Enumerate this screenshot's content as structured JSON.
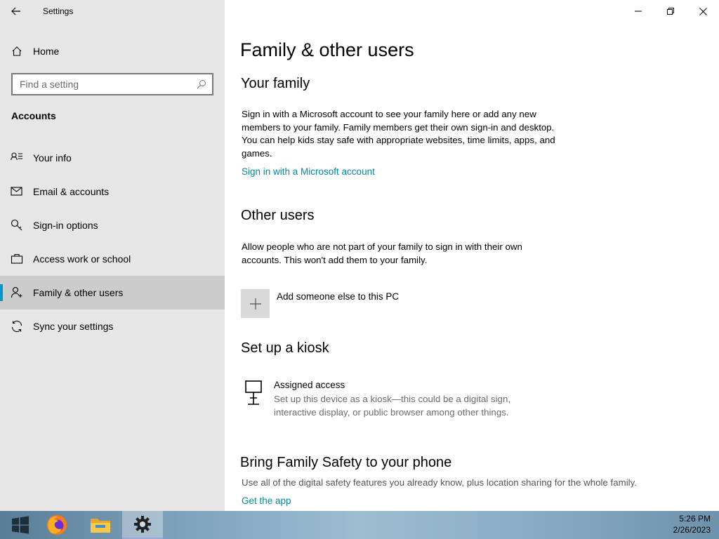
{
  "app": {
    "title": "Settings"
  },
  "sidebar": {
    "home_label": "Home",
    "search_placeholder": "Find a setting",
    "section": "Accounts",
    "items": [
      {
        "label": "Your info",
        "icon": "person-list-icon"
      },
      {
        "label": "Email & accounts",
        "icon": "mail-icon"
      },
      {
        "label": "Sign-in options",
        "icon": "key-icon"
      },
      {
        "label": "Access work or school",
        "icon": "briefcase-icon"
      },
      {
        "label": "Family & other users",
        "icon": "person-add-icon",
        "selected": true
      },
      {
        "label": "Sync your settings",
        "icon": "sync-icon"
      }
    ]
  },
  "main": {
    "title": "Family & other users",
    "family": {
      "heading": "Your family",
      "text": "Sign in with a Microsoft account to see your family here or add any new members to your family. Family members get their own sign-in and desktop. You can help kids stay safe with appropriate websites, time limits, apps, and games.",
      "link": "Sign in with a Microsoft account"
    },
    "other": {
      "heading": "Other users",
      "text": "Allow people who are not part of your family to sign in with their own accounts. This won't add them to your family.",
      "add_label": "Add someone else to this PC"
    },
    "kiosk": {
      "heading": "Set up a kiosk",
      "title": "Assigned access",
      "desc": "Set up this device as a kiosk—this could be a digital sign, interactive display, or public browser among other things."
    },
    "safety": {
      "heading": "Bring Family Safety to your phone",
      "desc": "Use all of the digital safety features you already know, plus location sharing for the whole family.",
      "link": "Get the app"
    }
  },
  "taskbar": {
    "time": "5:26 PM",
    "date": "2/26/2023",
    "apps": [
      "start-icon",
      "firefox-icon",
      "file-explorer-icon",
      "settings-gear-icon"
    ]
  },
  "colors": {
    "accent": "#0096c8",
    "link": "#008a9e",
    "sidebar_bg": "#e6e6e6",
    "selected_bg": "#cccccc"
  }
}
